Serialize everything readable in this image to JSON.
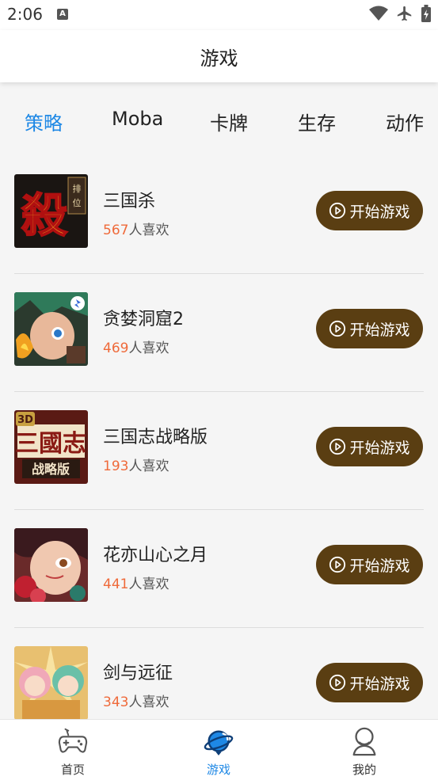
{
  "status_bar": {
    "time": "2:06"
  },
  "header": {
    "title": "游戏"
  },
  "tabs": [
    {
      "label": "策略",
      "active": true
    },
    {
      "label": "Moba",
      "active": false
    },
    {
      "label": "卡牌",
      "active": false
    },
    {
      "label": "生存",
      "active": false
    },
    {
      "label": "动作",
      "active": false
    }
  ],
  "games": [
    {
      "name": "三国杀",
      "likes": "567",
      "likes_suffix": "人喜欢",
      "button": "开始游戏",
      "thumb_icon": "sanguosha-logo"
    },
    {
      "name": "贪婪洞窟2",
      "likes": "469",
      "likes_suffix": "人喜欢",
      "button": "开始游戏",
      "thumb_icon": "greedy-cave-character"
    },
    {
      "name": "三国志战略版",
      "likes": "193",
      "likes_suffix": "人喜欢",
      "button": "开始游戏",
      "thumb_icon": "sanguozhi-logo"
    },
    {
      "name": "花亦山心之月",
      "likes": "441",
      "likes_suffix": "人喜欢",
      "button": "开始游戏",
      "thumb_icon": "flower-moon-portrait"
    },
    {
      "name": "剑与远征",
      "likes": "343",
      "likes_suffix": "人喜欢",
      "button": "开始游戏",
      "thumb_icon": "afk-arena-characters"
    }
  ],
  "bottom_nav": [
    {
      "label": "首页",
      "icon": "gamepad-icon",
      "active": false
    },
    {
      "label": "游戏",
      "icon": "planet-icon",
      "active": true
    },
    {
      "label": "我的",
      "icon": "user-icon",
      "active": false
    }
  ],
  "colors": {
    "accent": "#1e88e5",
    "button_bg": "#5a3e12",
    "likes_count": "#ef6a3a"
  }
}
